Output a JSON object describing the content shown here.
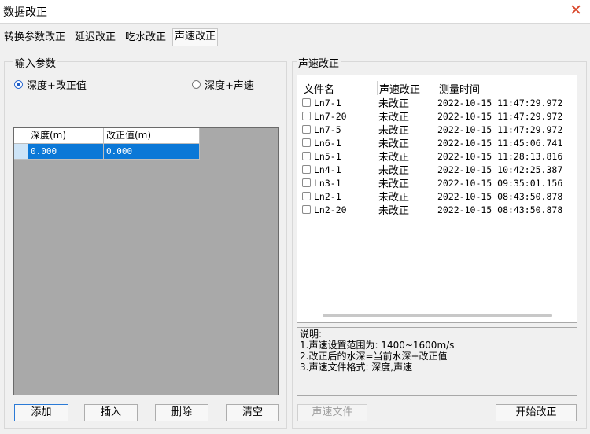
{
  "window": {
    "title": "数据改正",
    "close_icon": "close-icon"
  },
  "tabs": [
    {
      "label": "转换参数改正",
      "active": false
    },
    {
      "label": "延迟改正",
      "active": false
    },
    {
      "label": "吃水改正",
      "active": false
    },
    {
      "label": "声速改正",
      "active": true
    }
  ],
  "input": {
    "group_label": "输入参数",
    "radio_options": [
      {
        "label": "深度+改正值",
        "selected": true
      },
      {
        "label": "深度+声速",
        "selected": false
      }
    ],
    "table": {
      "columns": [
        "深度(m)",
        "改正值(m)"
      ],
      "rows": [
        [
          "0.000",
          "0.000"
        ]
      ]
    },
    "buttons": {
      "add": "添加",
      "insert": "插入",
      "delete": "删除",
      "clear": "清空"
    }
  },
  "sound": {
    "group_label": "声速改正",
    "columns": [
      "文件名",
      "声速改正",
      "测量时间"
    ],
    "files": [
      {
        "name": "Ln7-1",
        "status": "未改正",
        "time": "2022-10-15 11:47:29.972"
      },
      {
        "name": "Ln7-20",
        "status": "未改正",
        "time": "2022-10-15 11:47:29.972"
      },
      {
        "name": "Ln7-5",
        "status": "未改正",
        "time": "2022-10-15 11:47:29.972"
      },
      {
        "name": "Ln6-1",
        "status": "未改正",
        "time": "2022-10-15 11:45:06.741"
      },
      {
        "name": "Ln5-1",
        "status": "未改正",
        "time": "2022-10-15 11:28:13.816"
      },
      {
        "name": "Ln4-1",
        "status": "未改正",
        "time": "2022-10-15 10:42:25.387"
      },
      {
        "name": "Ln3-1",
        "status": "未改正",
        "time": "2022-10-15 09:35:01.156"
      },
      {
        "name": "Ln2-1",
        "status": "未改正",
        "time": "2022-10-15 08:43:50.878"
      },
      {
        "name": "Ln2-20",
        "status": "未改正",
        "time": "2022-10-15 08:43:50.878"
      }
    ],
    "notes": [
      "说明:",
      "1.声速设置范围为: 1400~1600m/s",
      "2.改正后的水深=当前水深+改正值",
      "3.声速文件格式: 深度,声速"
    ],
    "buttons": {
      "sound_file": "声速文件",
      "start": "开始改正"
    }
  },
  "colors": {
    "selection": "#0b78d7",
    "close": "#d9472b",
    "accent_border": "#2b7ad6"
  }
}
